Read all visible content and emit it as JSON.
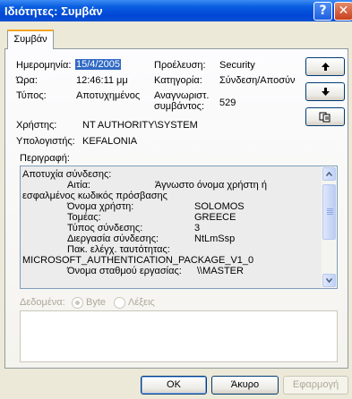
{
  "window": {
    "title": "Ιδιότητες: Συμβάν",
    "help_glyph": "?",
    "close_glyph": "✕"
  },
  "tab": {
    "label": "Συμβάν"
  },
  "fields": {
    "date_label": "Ημερομηνία:",
    "date_value": "15/4/2005",
    "time_label": "Ώρα:",
    "time_value": "12:46:11 μμ",
    "type_label": "Τύπος:",
    "type_value": "Αποτυχημένος",
    "user_label": "Χρήστης:",
    "user_value": "NT AUTHORITY\\SYSTEM",
    "computer_label": "Υπολογιστής:",
    "computer_value": "KEFALONIA",
    "source_label": "Προέλευση:",
    "source_value": "Security",
    "category_label": "Κατηγορία:",
    "category_value": "Σύνδεση/Αποσύν",
    "event_id_label_1": "Αναγνωριστ.",
    "event_id_label_2": "συμβάντος:",
    "event_id_value": "529"
  },
  "description": {
    "label": "Περιγραφή:",
    "lines": [
      [
        "Αποτυχία σύνδεσης:",
        ""
      ],
      [
        "Αιτία:",
        "Άγνωστο όνομα χρήστη ή"
      ],
      [
        "εσφαλμένος κωδικός πρόσβασης",
        ""
      ],
      [
        "Όνομα χρήστη:",
        "SOLOMOS"
      ],
      [
        "Τομέας:",
        "GREECE"
      ],
      [
        "Τύπος σύνδεσης:",
        "3"
      ],
      [
        "Διεργασία σύνδεσης:",
        "NtLmSsp"
      ],
      [
        "Πακ. ελέγχ. ταυτότητας:",
        ""
      ],
      [
        "MICROSOFT_AUTHENTICATION_PACKAGE_V1_0",
        ""
      ],
      [
        "Όνομα σταθμού εργασίας:",
        "\\\\MASTER"
      ]
    ]
  },
  "data_section": {
    "label": "Δεδομένα:",
    "option_bytes": "Byte",
    "option_words": "Λέξεις",
    "selected": "Byte"
  },
  "buttons": {
    "ok": "OK",
    "cancel": "Άκυρο",
    "apply": "Εφαρμογή"
  }
}
